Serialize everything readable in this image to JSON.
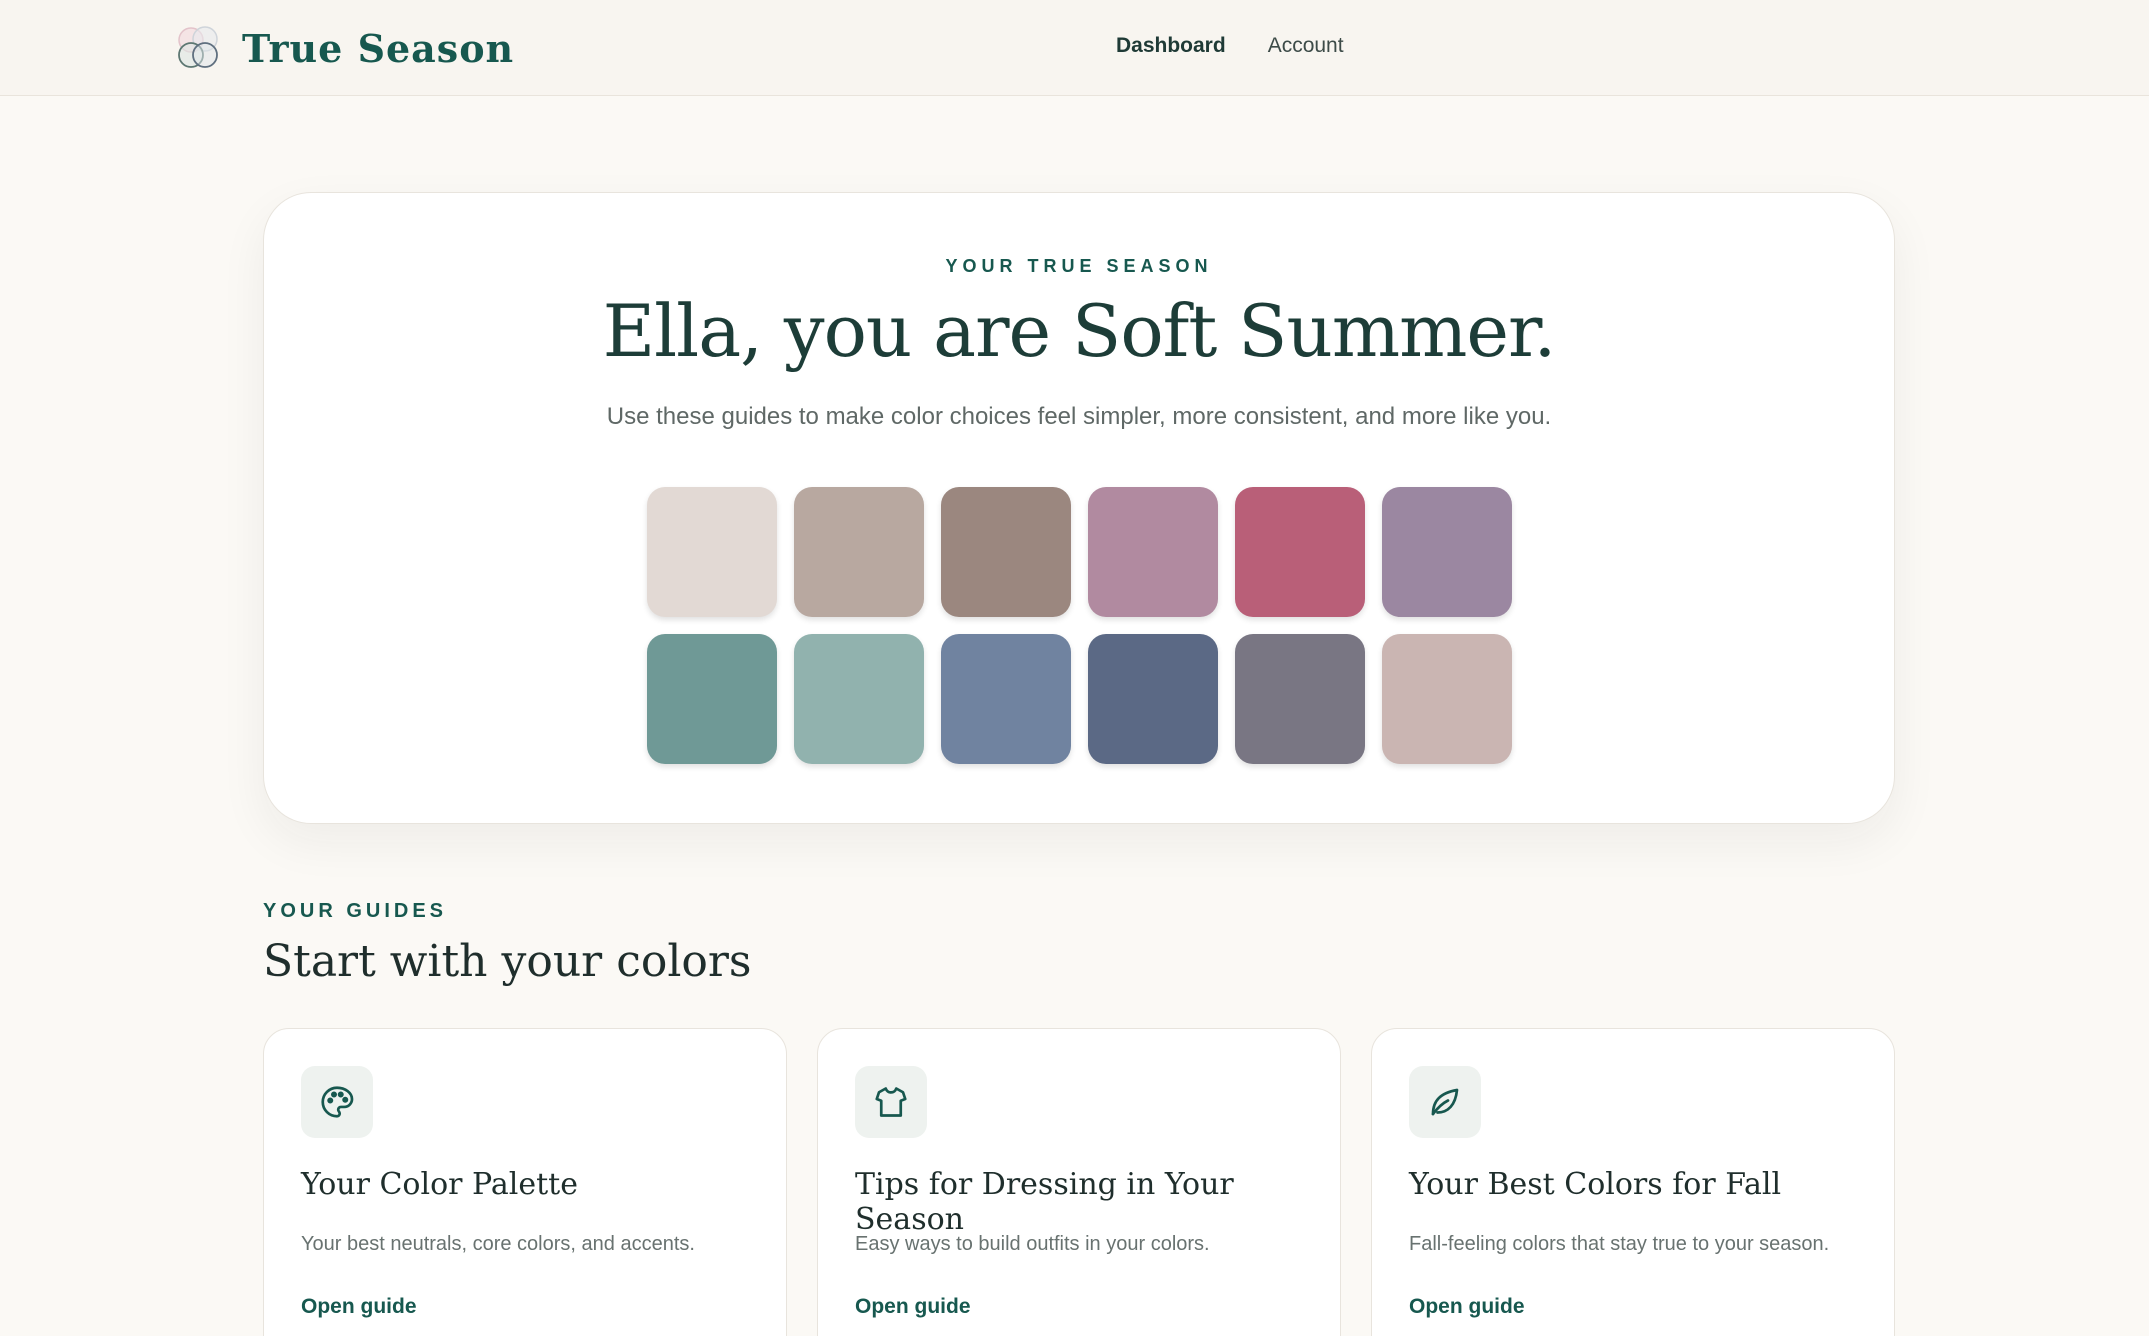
{
  "header": {
    "brand_name": "True Season",
    "nav": [
      {
        "label": "Dashboard",
        "active": true
      },
      {
        "label": "Account",
        "active": false
      }
    ]
  },
  "hero": {
    "eyebrow": "YOUR TRUE SEASON",
    "title": "Ella, you are Soft Summer.",
    "subtitle": "Use these guides to make color choices feel simpler, more consistent, and more like you.",
    "swatches": [
      "#e2d9d4",
      "#b8a8a0",
      "#9b877f",
      "#b18aa0",
      "#b95f78",
      "#9b87a1",
      "#6f9996",
      "#91b2ae",
      "#7083a0",
      "#5b6985",
      "#797683",
      "#cab5b2"
    ]
  },
  "guides": {
    "eyebrow": "YOUR GUIDES",
    "title": "Start with your colors",
    "cards": [
      {
        "icon": "palette-icon",
        "title": "Your Color Palette",
        "description": "Your best neutrals, core colors, and accents.",
        "link": "Open guide"
      },
      {
        "icon": "shirt-icon",
        "title": "Tips for Dressing in Your Season",
        "description": "Easy ways to build outfits in your colors.",
        "link": "Open guide"
      },
      {
        "icon": "leaf-icon",
        "title": "Your Best Colors for Fall",
        "description": "Fall-feeling colors that stay true to your season.",
        "link": "Open guide"
      }
    ]
  },
  "colors": {
    "accent": "#17584f",
    "background": "#fbf9f5"
  }
}
